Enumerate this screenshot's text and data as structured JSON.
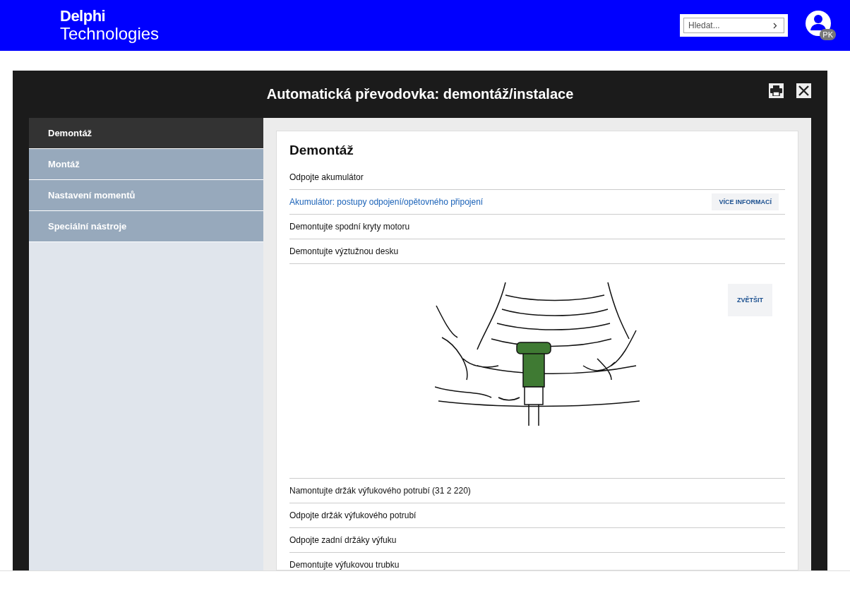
{
  "header": {
    "logo": {
      "line_1": "Delphi",
      "line_2": "Technologies"
    },
    "search": {
      "placeholder": "Hledat..."
    },
    "user": {
      "initials": "PK"
    }
  },
  "dialog": {
    "title": "Automatická převodovka: demontáž/instalace",
    "sidebar": {
      "items": [
        {
          "label": "Demontáž",
          "selected": true
        },
        {
          "label": "Montáž",
          "selected": false
        },
        {
          "label": "Nastavení momentů",
          "selected": false
        },
        {
          "label": "Speciální nástroje",
          "selected": false
        }
      ]
    },
    "section": {
      "title": "Demontáž",
      "steps": [
        {
          "kind": "text",
          "text": "Odpojte akumulátor"
        },
        {
          "kind": "link",
          "text": "Akumulátor: postupy odpojení/opětovného připojení",
          "button": "VÍCE INFORMACÍ"
        },
        {
          "kind": "text",
          "text": "Demontujte spodní kryty motoru"
        },
        {
          "kind": "text",
          "text": "Demontujte výztužnou desku"
        },
        {
          "kind": "image",
          "button": "ZVĚTŠIT"
        },
        {
          "kind": "text",
          "text": "Namontujte držák výfukového potrubí (31 2 220)"
        },
        {
          "kind": "text",
          "text": "Odpojte držák výfukového potrubí"
        },
        {
          "kind": "text",
          "text": "Odpojte zadní držáky výfuku"
        },
        {
          "kind": "text",
          "text": "Demontujte výfukovou trubku"
        }
      ]
    }
  }
}
